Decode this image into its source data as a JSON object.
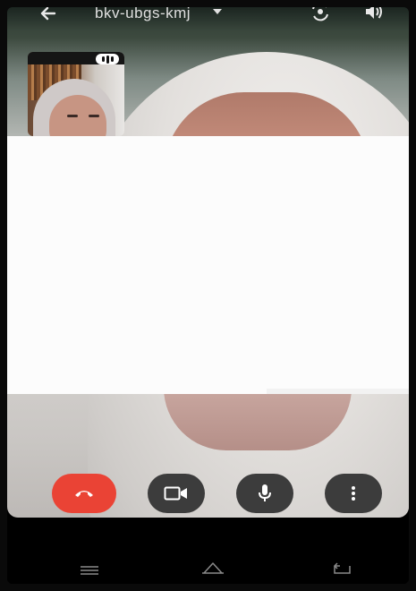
{
  "call": {
    "meeting_code": "bkv-ubgs-kmj"
  },
  "colors": {
    "end_call": "#ea4335",
    "control_bg": "#3c3c3c",
    "nav_bg": "#000000",
    "redaction": "#fcfcfc"
  },
  "icons": {
    "back": "arrow-left",
    "switch_camera": "switch-camera",
    "speaker": "volume",
    "end_call": "phone-hangup",
    "camera": "video-camera",
    "mic": "microphone",
    "more": "more-vertical",
    "nav_recents": "menu-lines",
    "nav_home": "home",
    "nav_back": "return"
  }
}
